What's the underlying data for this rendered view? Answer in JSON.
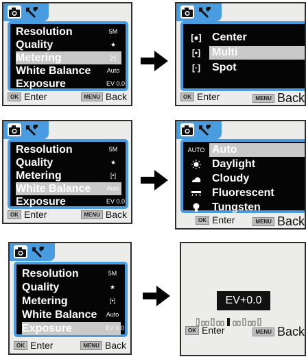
{
  "main_menu": {
    "items": [
      {
        "label": "Resolution",
        "indicator": "5M"
      },
      {
        "label": "Quality",
        "indicator": "★"
      },
      {
        "label": "Metering",
        "indicator": "[•]"
      },
      {
        "label": "White Balance",
        "indicator": "Auto"
      },
      {
        "label": "Exposure",
        "indicator": "EV 0.0"
      }
    ]
  },
  "screen1": {
    "selected": "Metering"
  },
  "screen2": {
    "items": [
      {
        "icon": "[●]",
        "label": "Center"
      },
      {
        "icon": "[▪]",
        "label": "Multi"
      },
      {
        "icon": "[·]",
        "label": "Spot"
      }
    ],
    "selected": "Multi"
  },
  "screen3": {
    "selected": "White Balance"
  },
  "screen4": {
    "items": [
      {
        "icon": "AUTO",
        "label": "Auto"
      },
      {
        "icon": "sun",
        "label": "Daylight"
      },
      {
        "icon": "cloud",
        "label": "Cloudy"
      },
      {
        "icon": "fluorescent",
        "label": "Fluorescent"
      },
      {
        "icon": "bulb",
        "label": "Tungsten"
      }
    ],
    "selected": "Auto"
  },
  "screen5": {
    "selected": "Exposure"
  },
  "screen6": {
    "ev_value": "EV+0.0"
  },
  "footer": {
    "ok_key": "OK",
    "enter": "Enter",
    "menu_key": "MENU",
    "back": "Back"
  },
  "colors": {
    "accent": "#4a9ce0",
    "panel": "#050505",
    "screen": "#ecedea",
    "highlight": "#c9c9c9"
  }
}
